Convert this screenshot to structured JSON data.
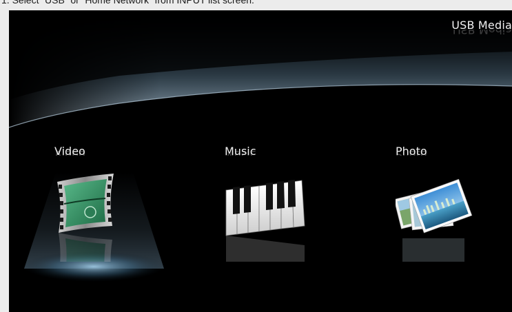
{
  "instruction": "1. Select “USB” or “Home Network” from INPUT list screen.",
  "header": {
    "title": "USB Media"
  },
  "menu": {
    "items": [
      {
        "label": "Video",
        "icon": "film-reel-icon",
        "selected": true
      },
      {
        "label": "Music",
        "icon": "piano-keys-icon",
        "selected": false
      },
      {
        "label": "Photo",
        "icon": "photo-stack-icon",
        "selected": false
      }
    ]
  },
  "colors": {
    "background": "#000000",
    "spotlight": "#8fc4e8",
    "text": "#f0f0f0",
    "film_green": "#2f8f5e"
  }
}
